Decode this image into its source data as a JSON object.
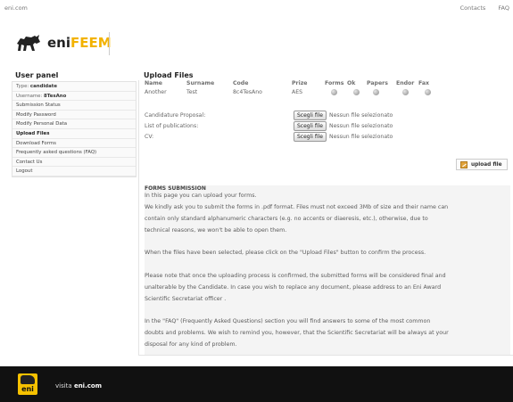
{
  "topbar": {
    "site": "eni.com",
    "contacts": "Contacts",
    "faq": "FAQ"
  },
  "logo": {
    "eni": "eni",
    "feem": "FEEM"
  },
  "sidebar": {
    "title": "User panel",
    "type_label": "Type:",
    "type_value": "candidate",
    "username_label": "Username:",
    "username_value": "8TesAno",
    "items": [
      "Submission Status",
      "Modify Password",
      "Modify Personal Data",
      "Upload Files",
      "Download Forms",
      "Frequently asked questions (FAQ)",
      "Contact Us",
      "Logout"
    ]
  },
  "main": {
    "title": "Upload Files",
    "columns": [
      "Name",
      "Surname",
      "Code",
      "Prize",
      "Forms",
      "Ok",
      "Papers",
      "Endor",
      "Fax"
    ],
    "row": {
      "name": "Another",
      "surname": "Test",
      "code": "8c4TesAno",
      "prize": "AES"
    },
    "uploads": [
      {
        "label": "Candidature Proposal:",
        "button": "Scegli file",
        "status": "Nessun file selezionato"
      },
      {
        "label": "List of publications:",
        "button": "Scegli file",
        "status": "Nessun file selezionato"
      },
      {
        "label": "CV:",
        "button": "Scegli file",
        "status": "Nessun file selezionato"
      }
    ],
    "upload_button": "upload file",
    "forms_submission": {
      "title": "FORMS SUBMISSION",
      "lines": [
        "In this page you can upload your forms.",
        "We kindly ask you to submit the forms in .pdf format. Files must not exceed 3Mb of size and their name can",
        "contain only standard alphanumeric characters (e.g. no accents or diaeresis, etc.), otherwise, due to",
        "technical reasons, we won't be able to open them.",
        "When the files have been selected, please click on the \"Upload Files\" button to confirm the process.",
        "Please note that once the uploading process is confirmed, the submitted forms will be considered final and",
        "unalterable by the Candidate. In case you wish to replace any document, please address to an Eni Award",
        "Scientific Secretariat officer .",
        "In the \"FAQ\" (Frequently Asked Questions) section you will find answers to some of the most common",
        "doubts and problems. We wish to remind you, however, that the Scientific Secretariat will be always at your",
        "disposal for any kind of problem."
      ]
    }
  },
  "footer": {
    "logo_text": "eni",
    "visita": "visita",
    "link": "eni.com"
  }
}
